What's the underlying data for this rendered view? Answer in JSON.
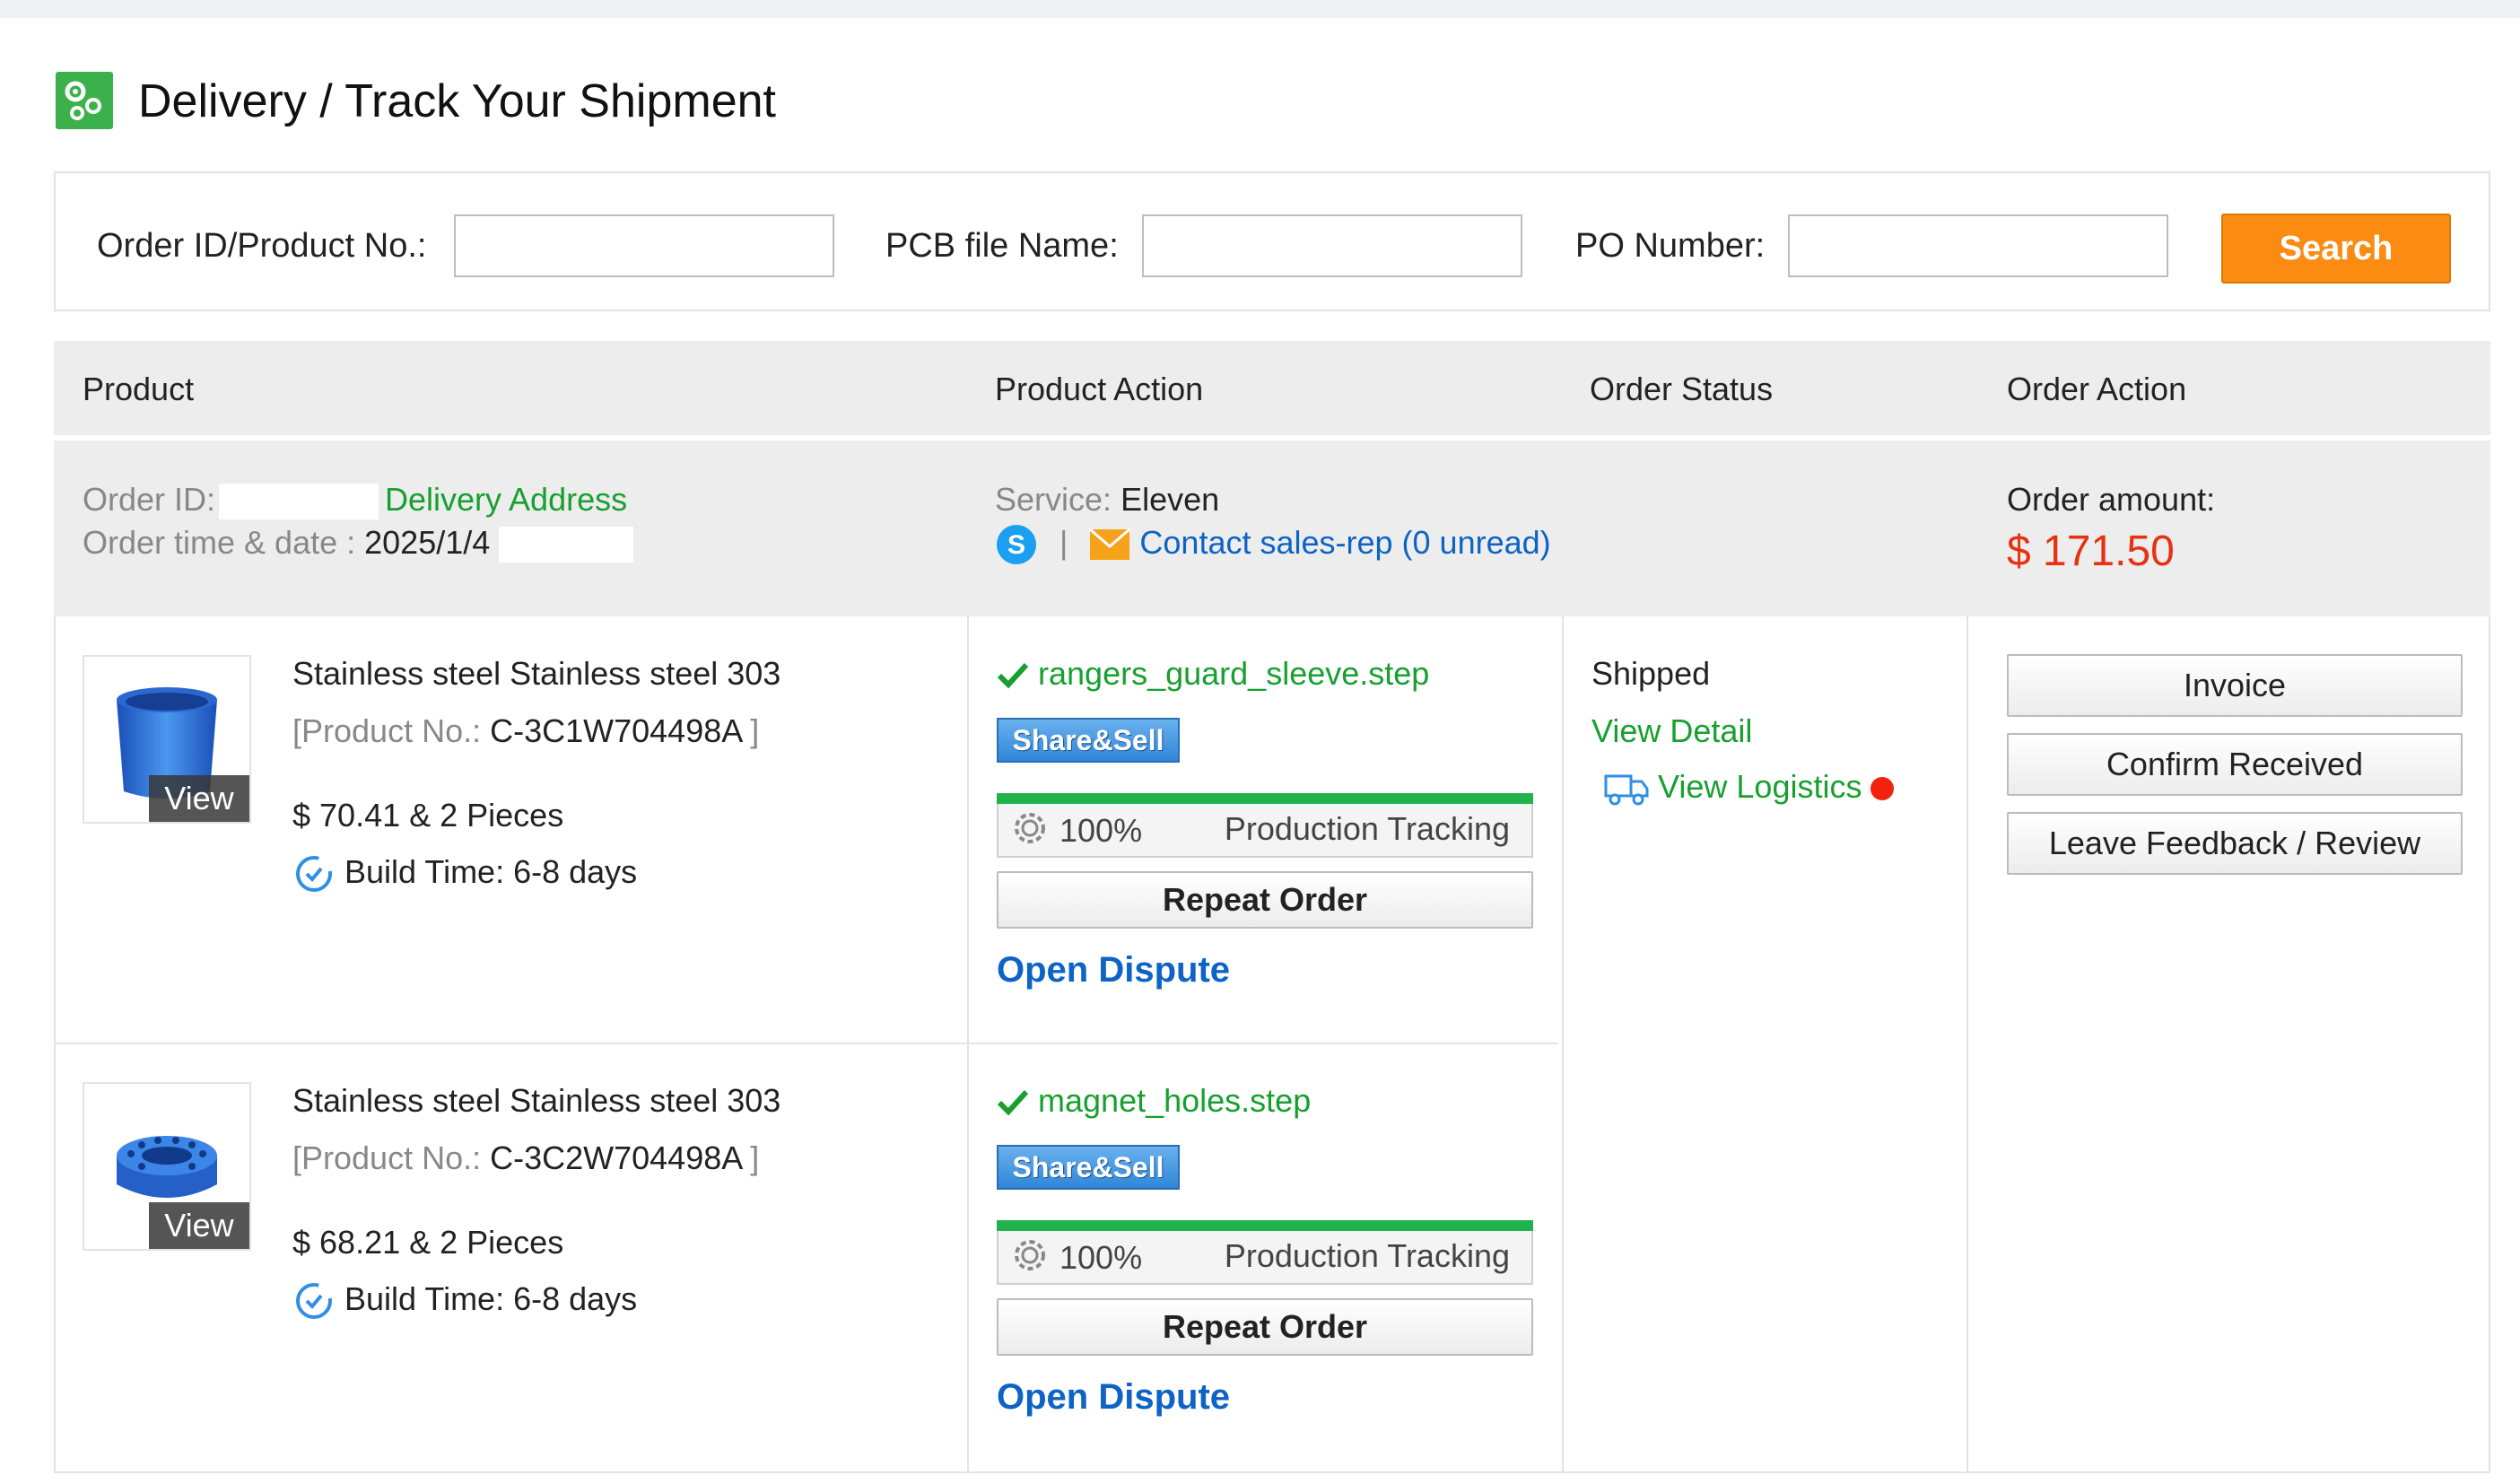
{
  "page": {
    "title": "Delivery / Track Your Shipment"
  },
  "search": {
    "order_label": "Order ID/Product No.:",
    "pcb_label": "PCB file Name:",
    "po_label": "PO Number:",
    "order_value": "",
    "pcb_value": "",
    "po_value": "",
    "button_label": "Search"
  },
  "table": {
    "headers": [
      "Product",
      "Product Action",
      "Order Status",
      "Order Action"
    ]
  },
  "order": {
    "id_label": "Order ID:",
    "delivery_address": "Delivery Address",
    "time_label": "Order time & date :",
    "date": "2025/1/4",
    "service_label": "Service:",
    "service_value": "Eleven",
    "separator": "|",
    "contact": "Contact sales-rep (0 unread)",
    "amount_label": "Order amount:",
    "amount": "$ 171.50",
    "status": "Shipped",
    "view_detail": "View Detail",
    "view_logistics": "View Logistics",
    "actions": {
      "invoice": "Invoice",
      "confirm": "Confirm Received",
      "feedback": "Leave Feedback / Review"
    }
  },
  "products": [
    {
      "name": "Stainless steel Stainless steel 303",
      "product_no_prefix": "[Product No.:",
      "product_no": "C-3C1W704498A",
      "product_no_suffix": "]",
      "price": "$ 70.41 & 2 Pieces",
      "build_time": "Build Time: 6-8 days",
      "view": "View",
      "file": "rangers_guard_sleeve.step",
      "share": "Share&Sell",
      "progress_pct": "100%",
      "progress_label": "Production Tracking",
      "progress_value": 1.0,
      "repeat": "Repeat Order",
      "dispute": "Open Dispute"
    },
    {
      "name": "Stainless steel Stainless steel 303",
      "product_no_prefix": "[Product No.:",
      "product_no": "C-3C2W704498A",
      "product_no_suffix": "]",
      "price": "$ 68.21 & 2 Pieces",
      "build_time": "Build Time: 6-8 days",
      "view": "View",
      "file": "magnet_holes.step",
      "share": "Share&Sell",
      "progress_pct": "100%",
      "progress_label": "Production Tracking",
      "progress_value": 1.0,
      "repeat": "Repeat Order",
      "dispute": "Open Dispute"
    }
  ],
  "colors": {
    "accent_orange": "#fb8c11",
    "link_blue": "#0d63c6",
    "success_green": "#17a02f",
    "amount_red": "#e63212",
    "progress_green": "#21b34b"
  },
  "icons": [
    "gear-cluster-icon",
    "skype-icon",
    "mail-icon",
    "check-icon",
    "refresh-clock-icon",
    "gear-icon",
    "truck-icon",
    "notification-dot"
  ]
}
